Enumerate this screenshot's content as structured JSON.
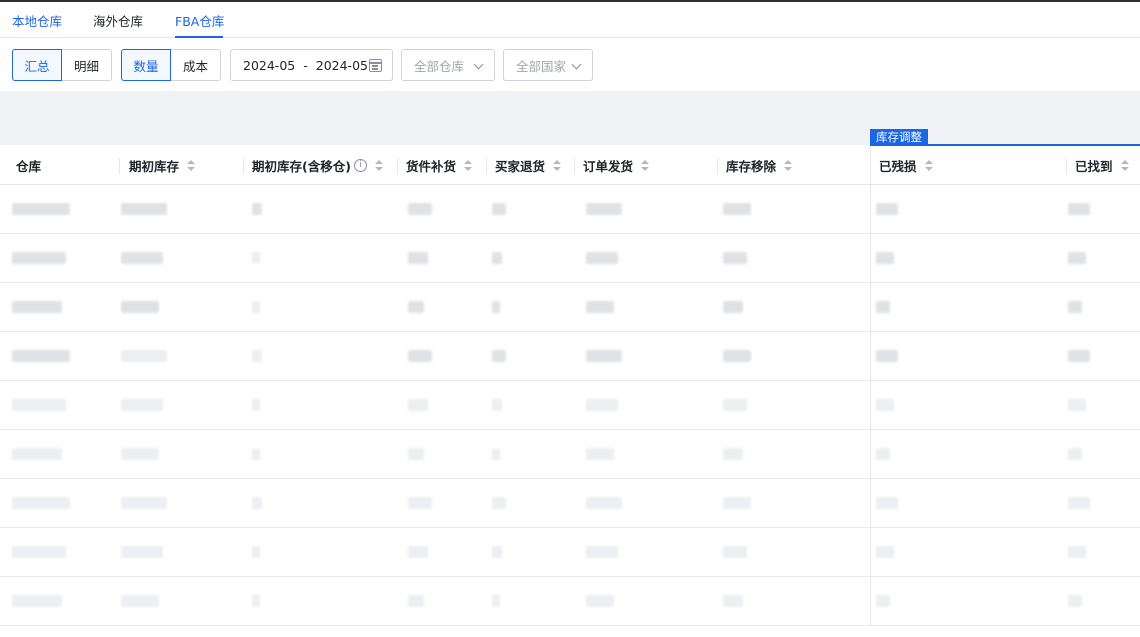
{
  "tabs": [
    {
      "label": "本地仓库",
      "active": false
    },
    {
      "label": "海外仓库",
      "active": false
    },
    {
      "label": "FBA仓库",
      "active": true
    }
  ],
  "toolbar": {
    "view_mode": {
      "options": [
        "汇总",
        "明细"
      ],
      "selected": "汇总"
    },
    "metric": {
      "options": [
        "数量",
        "成本"
      ],
      "selected": "数量"
    },
    "date_range": {
      "start": "2024-05",
      "end": "2024-05",
      "separator": "-"
    },
    "warehouse_select": {
      "placeholder": "全部仓库"
    },
    "country_select": {
      "placeholder": "全部国家"
    }
  },
  "table": {
    "group_header": "库存调整",
    "columns": [
      {
        "label": "仓库",
        "sortable": false
      },
      {
        "label": "期初库存",
        "sortable": true
      },
      {
        "label": "期初库存(含移仓)",
        "sortable": true,
        "info": true
      },
      {
        "label": "货件补货",
        "sortable": true
      },
      {
        "label": "买家退货",
        "sortable": true
      },
      {
        "label": "订单发货",
        "sortable": true
      },
      {
        "label": "库存移除",
        "sortable": true
      },
      {
        "label": "已残损",
        "sortable": true
      },
      {
        "label": "已找到",
        "sortable": true
      }
    ],
    "row_count": 9
  }
}
